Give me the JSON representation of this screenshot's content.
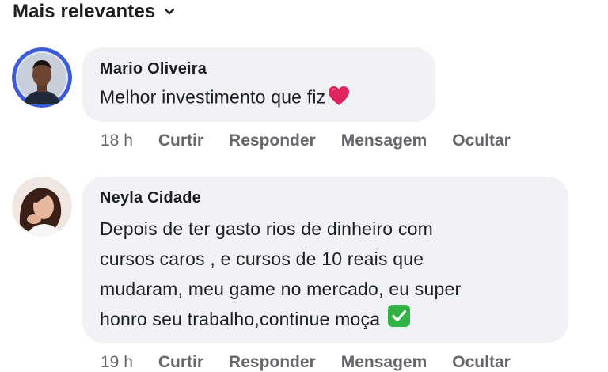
{
  "header": {
    "sort_label": "Mais relevantes"
  },
  "comments": [
    {
      "author": "Mario Oliveira",
      "text": "Melhor investimento que fiz",
      "emoji": "red-heart",
      "time": "18 h",
      "actions": [
        "Curtir",
        "Responder",
        "Mensagem",
        "Ocultar"
      ]
    },
    {
      "author": "Neyla Cidade",
      "text_lines": [
        "Depois de ter gasto rios de dinheiro com",
        "cursos caros , e  cursos de 10 reais que",
        "mudaram, meu game no mercado, eu super",
        "honro seu trabalho,continue moça"
      ],
      "emoji": "green-check",
      "time": "19 h",
      "actions": [
        "Curtir",
        "Responder",
        "Mensagem",
        "Ocultar"
      ]
    }
  ],
  "colors": {
    "bubble": "#f0f2f5",
    "secondary_text": "#65676b",
    "primary_text": "#1c1e21",
    "heart": "#e0245e",
    "check": "#2fb344"
  }
}
